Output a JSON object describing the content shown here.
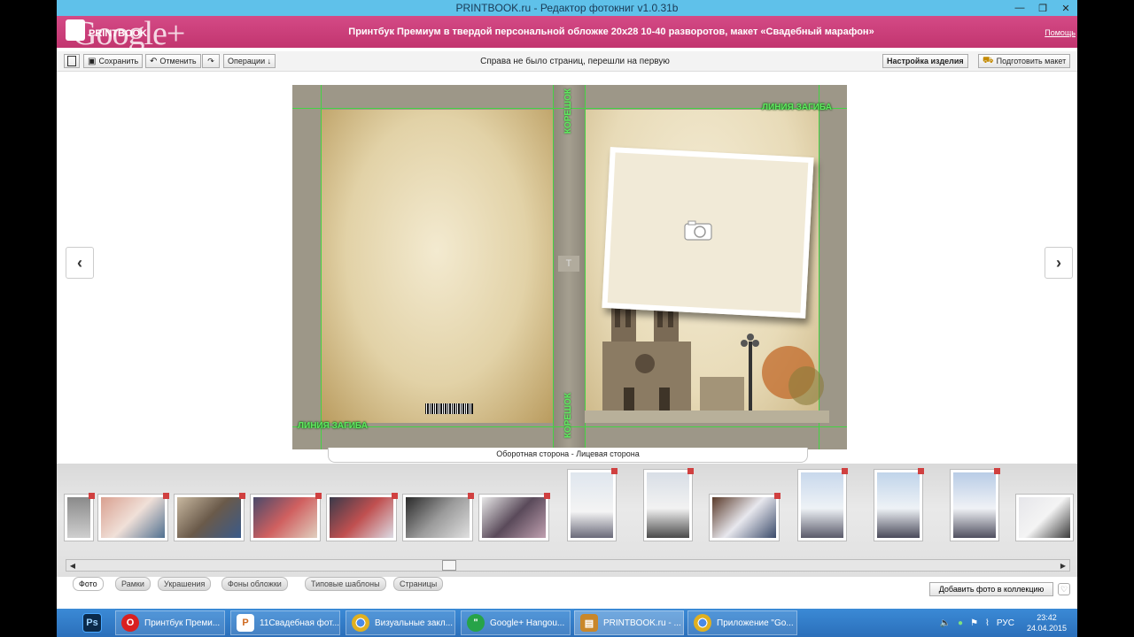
{
  "window": {
    "title": "PRINTBOOK.ru - Редактор фотокниг v1.0.31b",
    "ctrl_min": "—",
    "ctrl_max": "❐",
    "ctrl_close": "✕"
  },
  "header": {
    "logo_text": "PRINTBOOK",
    "overlay_text": "Google+",
    "product": "Принтбук Премиум в твердой персональной обложке 20х28 10-40 разворотов, макет «Свадебный марафон»",
    "help": "Помощь"
  },
  "toolbar": {
    "save": "Сохранить",
    "undo": "Отменить",
    "operations": "Операции ↓",
    "message": "Справа не было страниц, перешли на первую",
    "settings": "Настройка изделия",
    "prepare": "Подготовить макет"
  },
  "canvas": {
    "prev": "‹",
    "next": "›",
    "fold_label": "ЛИНИЯ ЗАГИБА",
    "spine_label": "КОРЕШОК",
    "spine_text": "T",
    "side_label": "Оборотная сторона - Лицевая сторона"
  },
  "bottom": {
    "tabs": [
      "Фото",
      "Рамки",
      "Украшения",
      "Фоны обложки",
      "Типовые шаблоны",
      "Страницы"
    ],
    "add_photo": "Добавить фото в коллекцию",
    "heart": "♡"
  },
  "taskbar": {
    "items": [
      {
        "label": "Ps",
        "color": "#0b2a4a"
      },
      {
        "label": "Принтбук Преми...",
        "color": "#d92020"
      },
      {
        "label": "11Свадебная фот...",
        "color": "#d06a20"
      },
      {
        "label": "Визуальные закл...",
        "color": "#e0b020"
      },
      {
        "label": "Google+ Hangou...",
        "color": "#27a348"
      },
      {
        "label": "PRINTBOOK.ru - ...",
        "color": "#c9872a"
      },
      {
        "label": "Приложение \"Go...",
        "color": "#e0b020"
      }
    ],
    "lang": "РУС",
    "time": "23:42",
    "date": "24.04.2015"
  }
}
